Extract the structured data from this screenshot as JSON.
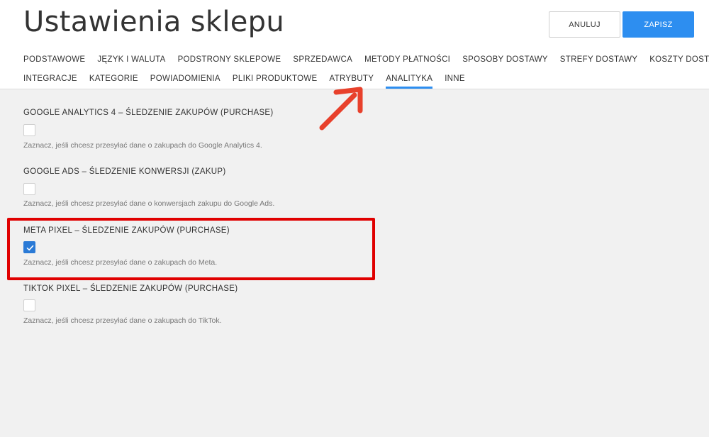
{
  "header": {
    "title": "Ustawienia sklepu",
    "cancel_label": "ANULUJ",
    "save_label": "ZAPISZ"
  },
  "tabs": {
    "row1": [
      "PODSTAWOWE",
      "JĘZYK I WALUTA",
      "PODSTRONY SKLEPOWE",
      "SPRZEDAWCA",
      "METODY PŁATNOŚCI",
      "SPOSOBY DOSTAWY",
      "STREFY DOSTAWY",
      "KOSZTY DOSTAWY"
    ],
    "row2": [
      "INTEGRACJE",
      "KATEGORIE",
      "POWIADOMIENIA",
      "PLIKI PRODUKTOWE",
      "ATRYBUTY",
      "ANALITYKA",
      "INNE"
    ],
    "active": "ANALITYKA"
  },
  "sections": [
    {
      "title": "GOOGLE ANALYTICS 4 – ŚLEDZENIE ZAKUPÓW (PURCHASE)",
      "checked": false,
      "help": "Zaznacz, jeśli chcesz przesyłać dane o zakupach do Google Analytics 4."
    },
    {
      "title": "GOOGLE ADS – ŚLEDZENIE KONWERSJI (ZAKUP)",
      "checked": false,
      "help": "Zaznacz, jeśli chcesz przesyłać dane o konwersjach zakupu do Google Ads."
    },
    {
      "title": "META PIXEL – ŚLEDZENIE ZAKUPÓW (PURCHASE)",
      "checked": true,
      "help": "Zaznacz, jeśli chcesz przesyłać dane o zakupach do Meta."
    },
    {
      "title": "TIKTOK PIXEL – ŚLEDZENIE ZAKUPÓW (PURCHASE)",
      "checked": false,
      "help": "Zaznacz, jeśli chcesz przesyłać dane o zakupach do TikTok."
    }
  ],
  "colors": {
    "accent": "#2d8ef0",
    "annotation": "#e00000",
    "checked": "#2a7ad6"
  },
  "icons": {
    "checkmark": "check-icon",
    "annotation_arrow": "arrow-up-right-icon"
  }
}
